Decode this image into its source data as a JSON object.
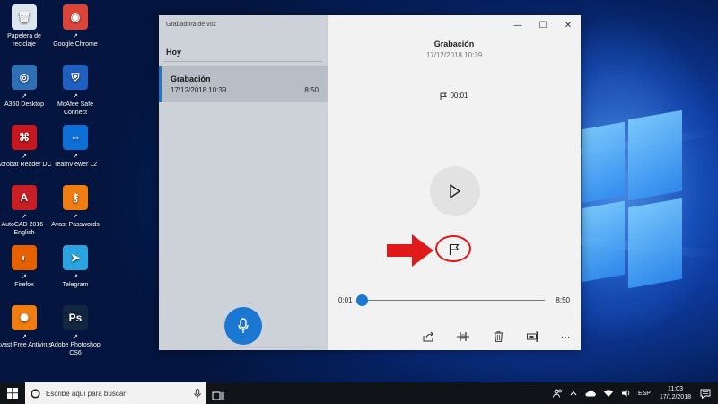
{
  "desktop": {
    "icons": [
      {
        "label": "Papelera de reciclaje",
        "icon": "recycle-bin-icon",
        "color": "#dde6ee",
        "glyph": "🗑"
      },
      {
        "label": "Google Chrome",
        "icon": "chrome-icon",
        "color": "#db4437",
        "glyph": "◉"
      },
      {
        "label": "A360 Desktop",
        "icon": "a360-icon",
        "color": "#2f6fb5",
        "glyph": "◎"
      },
      {
        "label": "McAfee Safe Connect",
        "icon": "mcafee-icon",
        "color": "#1f5fbf",
        "glyph": "⛨"
      },
      {
        "label": "Acrobat Reader DC",
        "icon": "acrobat-icon",
        "color": "#c8181e",
        "glyph": "⌘"
      },
      {
        "label": "TeamViewer 12",
        "icon": "teamviewer-icon",
        "color": "#0e6fd6",
        "glyph": "⇔"
      },
      {
        "label": "AutoCAD 2016 - English",
        "icon": "autocad-icon",
        "color": "#c81e24",
        "glyph": "A"
      },
      {
        "label": "Avast Passwords",
        "icon": "avast-passwords-icon",
        "color": "#f07d12",
        "glyph": "⚷"
      },
      {
        "label": "Firefox",
        "icon": "firefox-icon",
        "color": "#e66000",
        "glyph": "◐"
      },
      {
        "label": "Telegram",
        "icon": "telegram-icon",
        "color": "#2aa3e0",
        "glyph": "➤"
      },
      {
        "label": "Avast Free Antivirus",
        "icon": "avast-icon",
        "color": "#f07d12",
        "glyph": "✺"
      },
      {
        "label": "Adobe Photoshop CS6",
        "icon": "photoshop-icon",
        "color": "#12263f",
        "glyph": "Ps"
      }
    ]
  },
  "app": {
    "title": "Grabadora de voz",
    "group_header": "Hoy",
    "recording": {
      "name": "Grabación",
      "date": "17/12/2018 10:39",
      "duration": "8:50"
    },
    "main": {
      "title": "Grabación",
      "date": "17/12/2018 10:39",
      "marker_time": "00:01",
      "time_start": "0:01",
      "time_end": "8:50",
      "progress_fraction": 0.002
    },
    "window_controls": {
      "minimize": "—",
      "maximize": "☐",
      "close": "✕"
    },
    "toolbar_more": "⋯",
    "accent": "#1a78d2",
    "annotation_color": "#e01a1a"
  },
  "taskbar": {
    "search_placeholder": "Escribe aquí para buscar",
    "language": "ESP",
    "time": "11:03",
    "date": "17/12/2018"
  }
}
